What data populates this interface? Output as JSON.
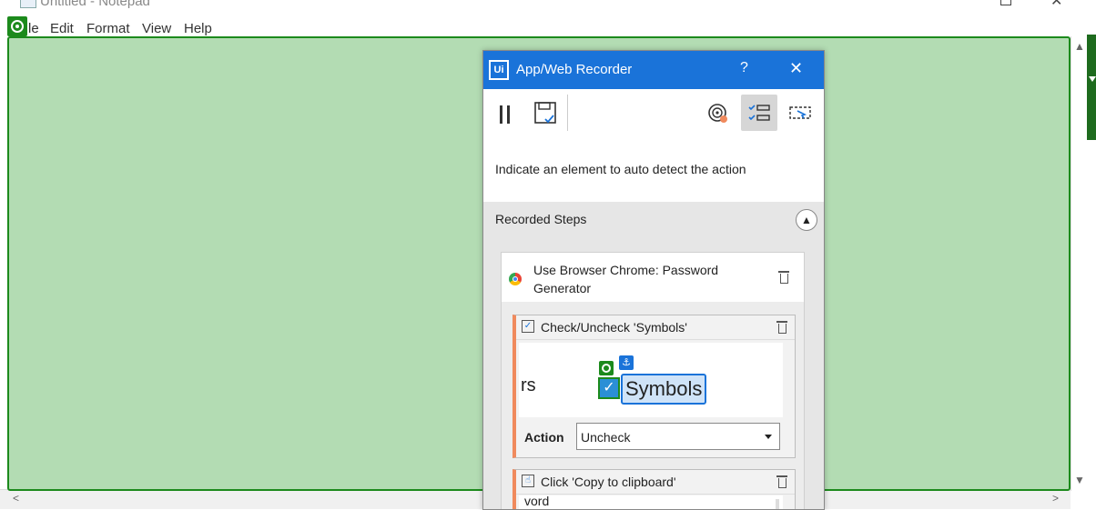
{
  "notepad": {
    "title": "Untitled - Notepad",
    "menu": [
      "File",
      "Edit",
      "Format",
      "View",
      "Help"
    ],
    "menu_visible": [
      "le",
      "Edit",
      "Format",
      "View",
      "Help"
    ]
  },
  "recorder": {
    "title": "App/Web Recorder",
    "help": "?",
    "close": "✕",
    "instruction": "Indicate an element to auto detect the action",
    "steps_header": "Recorded Steps",
    "scope": {
      "title": "Use Browser Chrome: Password Generator"
    },
    "steps": [
      {
        "title": "Check/Uncheck 'Symbols'",
        "preview_left": "rs",
        "preview_label": "Symbols",
        "action_label": "Action",
        "action_value": "Uncheck"
      },
      {
        "title": "Click 'Copy to clipboard'",
        "preview_text": "vord"
      }
    ]
  },
  "colors": {
    "highlight_fill": "#b3dcb3",
    "highlight_border": "#1c8a1c",
    "recorder_accent": "#1a73d9",
    "step_accent": "#f08a5d"
  }
}
